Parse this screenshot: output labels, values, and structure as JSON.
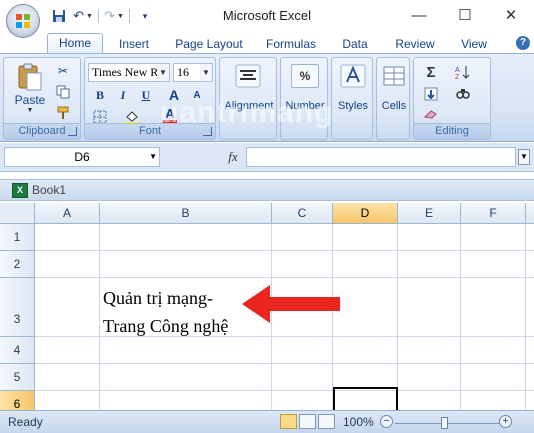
{
  "window": {
    "title": "Microsoft Excel"
  },
  "quick_access": {
    "save": "💾",
    "undo": "↶",
    "redo": "↷"
  },
  "window_controls": {
    "minimize": "—",
    "maximize": "☐",
    "close": "✕"
  },
  "tabs": [
    {
      "label": "Home",
      "active": true
    },
    {
      "label": "Insert"
    },
    {
      "label": "Page Layout"
    },
    {
      "label": "Formulas"
    },
    {
      "label": "Data"
    },
    {
      "label": "Review"
    },
    {
      "label": "View"
    }
  ],
  "ribbon": {
    "clipboard": {
      "label": "Clipboard",
      "paste": "Paste"
    },
    "font": {
      "label": "Font",
      "font_name": "Times New Ro",
      "font_size": "16",
      "bold": "B",
      "italic": "I",
      "underline": "U",
      "grow": "A",
      "shrink": "A",
      "font_color": "A"
    },
    "alignment": {
      "label": "Alignment"
    },
    "number": {
      "label": "Number",
      "symbol": "%"
    },
    "styles": {
      "label": "Styles"
    },
    "cells": {
      "label": "Cells"
    },
    "editing": {
      "label": "Editing",
      "sum": "Σ"
    }
  },
  "formula_bar": {
    "name_box": "D6",
    "fx": "fx",
    "value": ""
  },
  "workbook": {
    "name": "Book1"
  },
  "sheet": {
    "columns": [
      "A",
      "B",
      "C",
      "D",
      "E",
      "F"
    ],
    "selected_column": "D",
    "rows": [
      "1",
      "2",
      "3",
      "4",
      "5",
      "6"
    ],
    "selected_row": "6",
    "cell_B3_line1": "Quản trị mạng-",
    "cell_B3_line2": "Trang Công nghệ"
  },
  "watermark": "uantrimang",
  "status": {
    "ready": "Ready",
    "zoom": "100%",
    "zoom_out": "−",
    "zoom_in": "+"
  },
  "colors": {
    "arrow": "#e8261f",
    "selection": "#f8c66a",
    "ribbon": "#dde8f6"
  }
}
